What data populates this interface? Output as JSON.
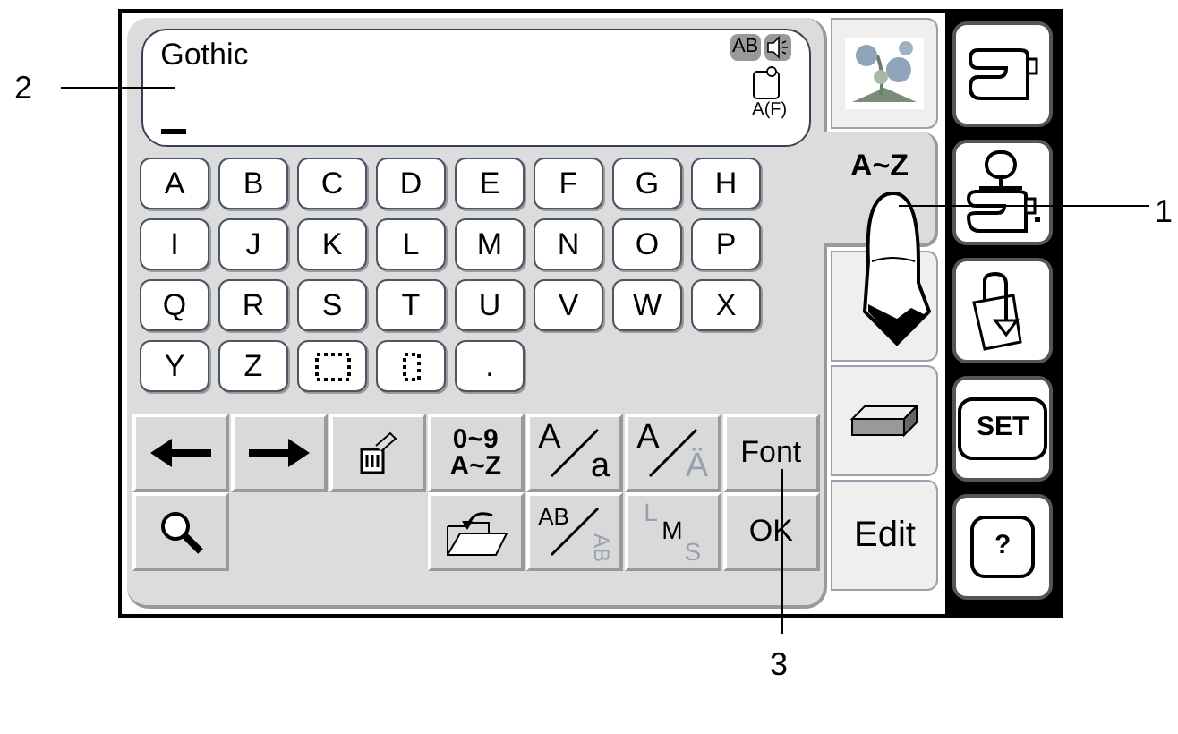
{
  "display": {
    "font_name": "Gothic",
    "mode_badge": "AB",
    "size_label": "A(F)"
  },
  "letter_rows": [
    [
      {
        "kind": "char",
        "label": "A"
      },
      {
        "kind": "char",
        "label": "B"
      },
      {
        "kind": "char",
        "label": "C"
      },
      {
        "kind": "char",
        "label": "D"
      },
      {
        "kind": "char",
        "label": "E"
      },
      {
        "kind": "char",
        "label": "F"
      },
      {
        "kind": "char",
        "label": "G"
      },
      {
        "kind": "char",
        "label": "H"
      }
    ],
    [
      {
        "kind": "char",
        "label": "I"
      },
      {
        "kind": "char",
        "label": "J"
      },
      {
        "kind": "char",
        "label": "K"
      },
      {
        "kind": "char",
        "label": "L"
      },
      {
        "kind": "char",
        "label": "M"
      },
      {
        "kind": "char",
        "label": "N"
      },
      {
        "kind": "char",
        "label": "O"
      },
      {
        "kind": "char",
        "label": "P"
      }
    ],
    [
      {
        "kind": "char",
        "label": "Q"
      },
      {
        "kind": "char",
        "label": "R"
      },
      {
        "kind": "char",
        "label": "S"
      },
      {
        "kind": "char",
        "label": "T"
      },
      {
        "kind": "char",
        "label": "U"
      },
      {
        "kind": "char",
        "label": "V"
      },
      {
        "kind": "char",
        "label": "W"
      },
      {
        "kind": "char",
        "label": "X"
      }
    ],
    [
      {
        "kind": "char",
        "label": "Y"
      },
      {
        "kind": "char",
        "label": "Z"
      },
      {
        "kind": "space"
      },
      {
        "kind": "narrow_space"
      },
      {
        "kind": "char",
        "label": "."
      }
    ]
  ],
  "function_rows": [
    [
      {
        "kind": "arrow_left"
      },
      {
        "kind": "arrow_right"
      },
      {
        "kind": "delete"
      },
      {
        "kind": "stack",
        "top": "0~9",
        "bottom": "A~Z"
      },
      {
        "kind": "slash",
        "top": "A",
        "bottom": "a"
      },
      {
        "kind": "slash_dim",
        "top": "A",
        "bottom": "Ä"
      },
      {
        "kind": "text",
        "label": "Font"
      }
    ],
    [
      {
        "kind": "search"
      },
      {
        "kind": "blank"
      },
      {
        "kind": "blank"
      },
      {
        "kind": "folder"
      },
      {
        "kind": "slash_rotated",
        "top": "AB",
        "bottom": "AB"
      },
      {
        "kind": "lms",
        "top": "L",
        "middle": "M",
        "bottom": "S"
      },
      {
        "kind": "text",
        "label": "OK"
      }
    ]
  ],
  "tabs": [
    {
      "kind": "picture",
      "selected": false
    },
    {
      "kind": "text",
      "label": "A~Z",
      "selected": true
    },
    {
      "kind": "empty",
      "selected": false
    },
    {
      "kind": "block",
      "selected": false
    },
    {
      "kind": "text",
      "label": "Edit",
      "selected": false
    }
  ],
  "side_buttons": [
    {
      "kind": "sewing"
    },
    {
      "kind": "embroidery"
    },
    {
      "kind": "bag"
    },
    {
      "kind": "text",
      "label": "SET"
    },
    {
      "kind": "text",
      "label": "?"
    }
  ],
  "callouts": [
    {
      "label": "1"
    },
    {
      "label": "2"
    },
    {
      "label": "3"
    }
  ]
}
